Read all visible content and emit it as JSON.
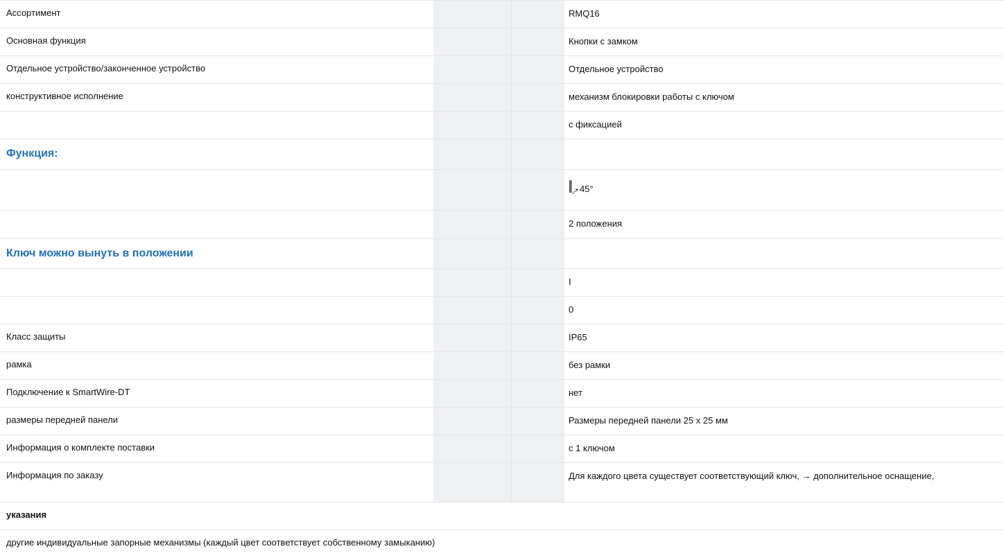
{
  "rows": [
    {
      "label": "Ассортимент",
      "value": "RMQ16"
    },
    {
      "label": "Основная функция",
      "value": "Кнопки с замком"
    },
    {
      "label": "Отдельное устройство/законченное устройство",
      "value": "Отдельное устройство"
    },
    {
      "label": "конструктивное исполнение",
      "value": "механизм блокировки работы с ключом"
    },
    {
      "label": "",
      "value": "с фиксацией"
    }
  ],
  "section_function": {
    "title": "Функция:"
  },
  "function_rows": [
    {
      "icon": "switch-angle-icon",
      "value": "45°"
    },
    {
      "value": "2 положения"
    }
  ],
  "section_key": {
    "title": "Ключ можно вынуть в положении"
  },
  "key_rows": [
    {
      "value": "I"
    },
    {
      "value": "0"
    }
  ],
  "rows2": [
    {
      "label": "Класс защиты",
      "value": "IP65"
    },
    {
      "label": "рамка",
      "value": "без рамки"
    },
    {
      "label": "Подключение к SmartWire-DT",
      "value": "нет"
    },
    {
      "label": "размеры передней панели",
      "value": "Размеры передней панели 25 x 25 мм"
    },
    {
      "label": "Информация о комплекте поставки",
      "value": "с 1 ключом"
    },
    {
      "label": "Информация по заказу",
      "value": "Для каждого цвета существует соответствующий ключ, → дополнительное оснащение,"
    }
  ],
  "notes": {
    "title": "указания",
    "text": "другие индивидуальные запорные механизмы (каждый цвет соответствует собственному замыканию)"
  }
}
